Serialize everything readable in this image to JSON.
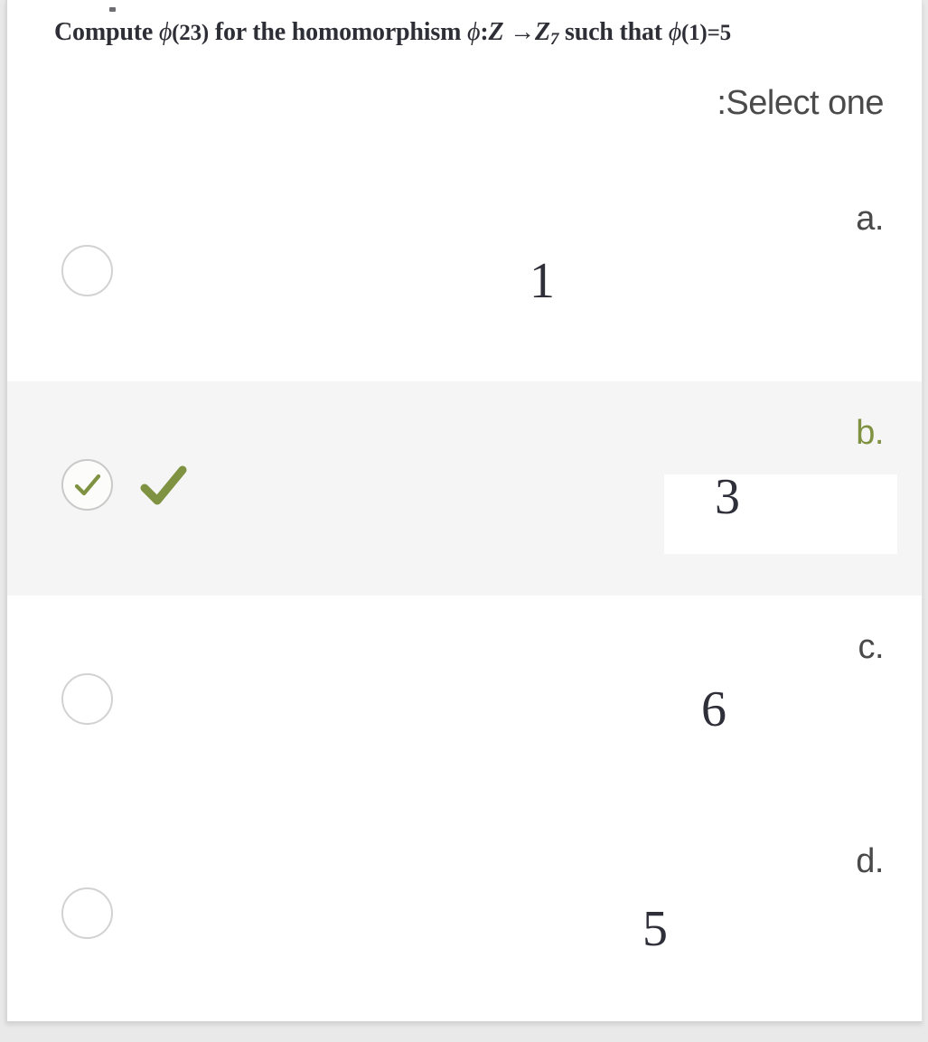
{
  "question": {
    "prefix": "Compute",
    "phi_arg": "(23)",
    "middle": "for the homomorphism",
    "map_symbol": "ϕ",
    "domain": "Z",
    "arrow": "→",
    "codomain": "Z",
    "codomain_sub": "7",
    "condition_prefix": "such that",
    "condition": "(1)",
    "condition_value": "=5",
    "full_text": "Compute ϕ(23) for the homomorphism ϕ: Z→Z7 such that ϕ(1)=5"
  },
  "select_prompt": ":Select one",
  "colors": {
    "selected_green": "#7e9241",
    "selected_row_bg": "#f5f5f5",
    "text_dark": "#2f2f3a",
    "label_gray": "#4a4a4a",
    "radio_border": "#d2d2d2",
    "page_bg": "#e9e9e9"
  },
  "options": [
    {
      "letter": "a.",
      "value": "1",
      "selected": false
    },
    {
      "letter": "b.",
      "value": "3",
      "selected": true
    },
    {
      "letter": "c.",
      "value": "6",
      "selected": false
    },
    {
      "letter": "d.",
      "value": "5",
      "selected": false
    }
  ],
  "icons": {
    "radio_empty": "radio-unchecked-icon",
    "radio_checked": "radio-checked-icon",
    "correct_mark": "checkmark-icon"
  }
}
